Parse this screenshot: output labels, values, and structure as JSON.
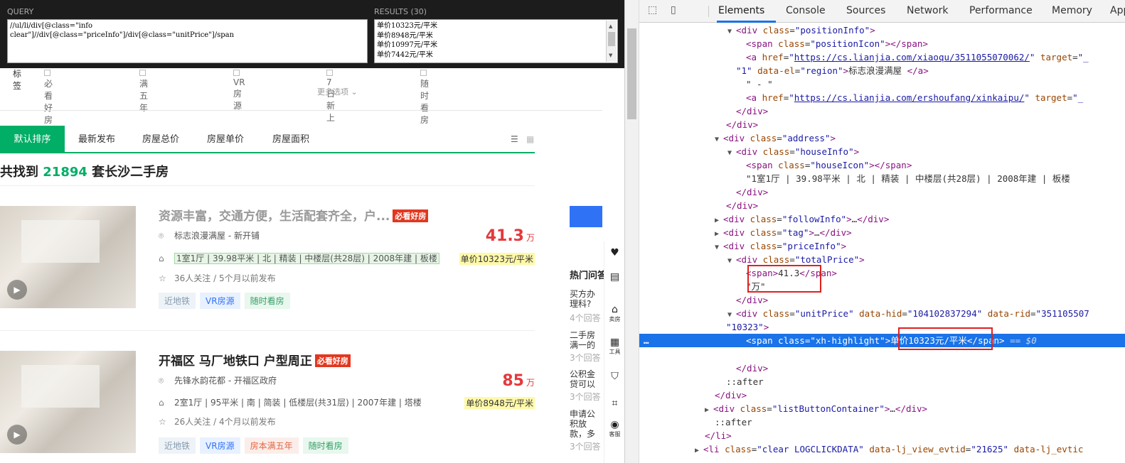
{
  "xpath_helper": {
    "query_label": "QUERY",
    "results_label": "RESULTS (30)",
    "query": "//ul/li/div[@class=\"info\nclear\"]//div[@class=\"priceInfo\"]/div[@class=\"unitPrice\"]/span",
    "results": [
      "单价10323元/平米",
      "单价8948元/平米",
      "单价10997元/平米",
      "单价7442元/平米"
    ]
  },
  "filters": {
    "label": "标签",
    "options": [
      "必看好房",
      "满五年",
      "VR房源",
      "7日新上",
      "随时看房"
    ],
    "more": "更多选项"
  },
  "sort_tabs": [
    "默认排序",
    "最新发布",
    "房屋总价",
    "房屋单价",
    "房屋面积"
  ],
  "total": {
    "prefix": "共找到 ",
    "count": "21894",
    "suffix": " 套长沙二手房"
  },
  "listings": [
    {
      "title": "资源丰富，交通方便，生活配套齐全，户...",
      "badge": "必看好房",
      "position": "标志浪漫满屋 - 新开铺",
      "house_info": "1室1厅 | 39.98平米 | 北 | 精装 | 中楼层(共28层) | 2008年建 | 板楼",
      "follow": "36人关注 / 5个月以前发布",
      "tags": [
        "近地铁",
        "VR房源",
        "随时看房"
      ],
      "price": "41.3",
      "price_unit": "万",
      "unit_price": "单价10323元/平米"
    },
    {
      "title": "开福区 马厂地铁口 户型周正",
      "badge": "必看好房",
      "position": "先锋水韵花都 - 开福区政府",
      "house_info": "2室1厅 | 95平米 | 南 | 简装 | 低楼层(共31层) | 2007年建 | 塔楼",
      "follow": "26人关注 / 4个月以前发布",
      "tags": [
        "近地铁",
        "VR房源",
        "房本满五年",
        "随时看房"
      ],
      "price": "85",
      "price_unit": "万",
      "unit_price": "单价8948元/平米"
    }
  ],
  "sidebar": {
    "hot_questions": "热门问答",
    "questions": [
      "买方办理科?",
      "二手房满一的区别",
      "公积金贷可以重复",
      "申请公积放款，多效?"
    ],
    "answers": [
      "4个回答",
      "3个回答",
      "3个回答",
      "3个回答"
    ],
    "icons": [
      {
        "icon": "heart-icon",
        "label": ""
      },
      {
        "icon": "calculator-icon",
        "label": ""
      },
      {
        "icon": "home-icon",
        "label": "卖房"
      },
      {
        "icon": "grid-icon",
        "label": "工具"
      },
      {
        "icon": "shield-icon",
        "label": ""
      },
      {
        "icon": "scan-icon",
        "label": ""
      },
      {
        "icon": "chat-icon",
        "label": "客服"
      }
    ]
  },
  "devtools": {
    "tabs": [
      "Elements",
      "Console",
      "Sources",
      "Network",
      "Performance",
      "Memory",
      "Application"
    ],
    "active_tab": "Elements",
    "address_text": "\"1室1厅 | 39.98平米 | 北 | 精装 | 中楼层(共28层) | 2008年建 | 板楼",
    "link1": "https://cs.lianjia.com/xiaoqu/3511055070062/",
    "link2": "https://cs.lianjia.com/ershoufang/xinkaipu/",
    "region_text": "标志浪漫满屋",
    "total_price_span": "41.3",
    "wan": "万",
    "data_hid": "104102837294",
    "data_rid": "351105507",
    "unit_attr": "10323",
    "highlight_span": "单价10323元/平米",
    "evtid": "21625",
    "dollar": "== $0"
  }
}
